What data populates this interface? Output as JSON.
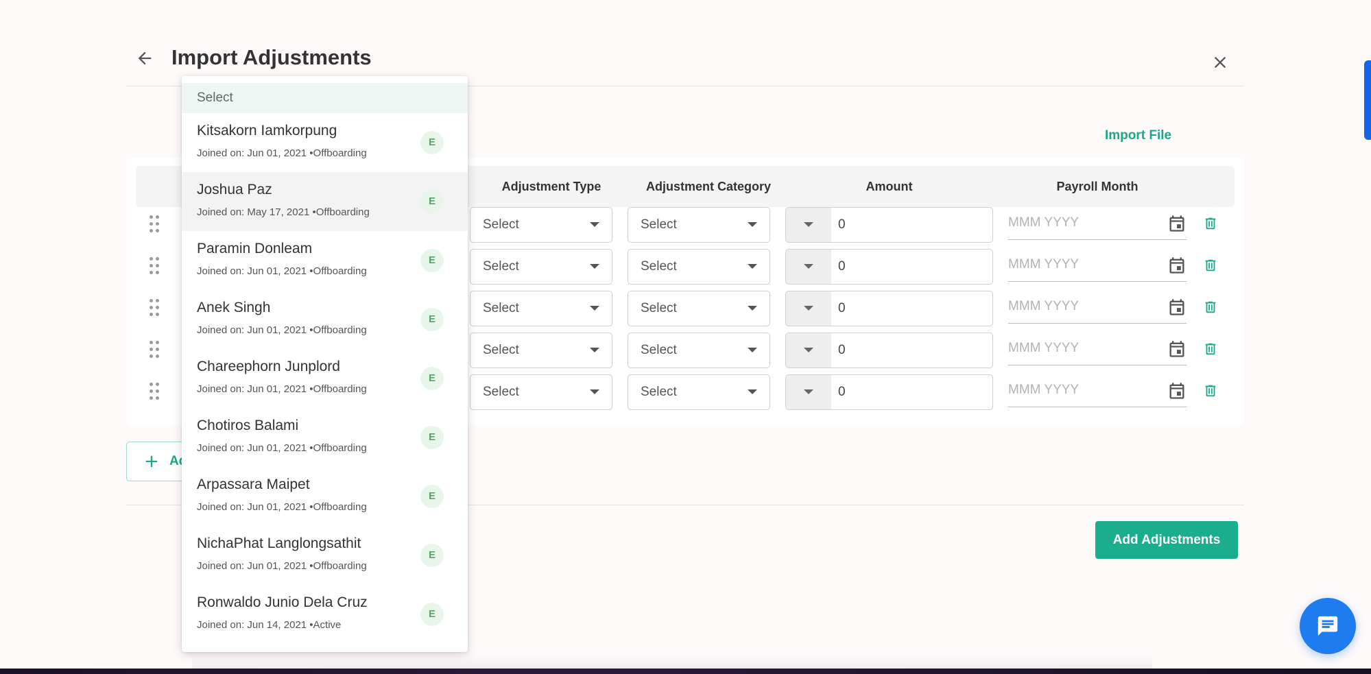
{
  "page": {
    "title": "Import Adjustments",
    "import_file_label": "Import File",
    "add_row_label": "Ad",
    "submit_label": "Add Adjustments"
  },
  "table": {
    "columns": [
      "Adjustment Type",
      "Adjustment Category",
      "Amount",
      "Payroll Month"
    ],
    "rows": [
      {
        "adjustment_type": "Select",
        "adjustment_category": "Select",
        "amount": "0",
        "payroll_month_placeholder": "MMM YYYY"
      },
      {
        "adjustment_type": "Select",
        "adjustment_category": "Select",
        "amount": "0",
        "payroll_month_placeholder": "MMM YYYY"
      },
      {
        "adjustment_type": "Select",
        "adjustment_category": "Select",
        "amount": "0",
        "payroll_month_placeholder": "MMM YYYY"
      },
      {
        "adjustment_type": "Select",
        "adjustment_category": "Select",
        "amount": "0",
        "payroll_month_placeholder": "MMM YYYY"
      },
      {
        "adjustment_type": "Select",
        "adjustment_category": "Select",
        "amount": "0",
        "payroll_month_placeholder": "MMM YYYY"
      }
    ]
  },
  "employee_dropdown": {
    "placeholder": "Select",
    "options": [
      {
        "name": "Kitsakorn Iamkorpung",
        "meta": "Joined on: Jun 01, 2021 •Offboarding",
        "badge": "E"
      },
      {
        "name": "Joshua Paz",
        "meta": "Joined on: May 17, 2021 •Offboarding",
        "badge": "E"
      },
      {
        "name": "Paramin Donleam",
        "meta": "Joined on: Jun 01, 2021 •Offboarding",
        "badge": "E"
      },
      {
        "name": "Anek Singh",
        "meta": "Joined on: Jun 01, 2021 •Offboarding",
        "badge": "E"
      },
      {
        "name": "Chareephorn Junplord",
        "meta": "Joined on: Jun 01, 2021 •Offboarding",
        "badge": "E"
      },
      {
        "name": "Chotiros Balami",
        "meta": "Joined on: Jun 01, 2021 •Offboarding",
        "badge": "E"
      },
      {
        "name": "Arpassara Maipet",
        "meta": "Joined on: Jun 01, 2021 •Offboarding",
        "badge": "E"
      },
      {
        "name": "NichaPhat Langlongsathit",
        "meta": "Joined on: Jun 01, 2021 •Offboarding",
        "badge": "E"
      },
      {
        "name": "Ronwaldo Junio Dela Cruz",
        "meta": "Joined on: Jun 14, 2021 •Active",
        "badge": "E"
      }
    ]
  },
  "icons": {
    "back": "arrow-left-icon",
    "close": "close-icon",
    "drag": "drag-handle-icon",
    "calendar": "calendar-icon",
    "delete": "trash-icon",
    "add": "plus-icon",
    "chat": "chat-icon"
  },
  "colors": {
    "accent": "#1aae8e",
    "accent_text": "#1aa88a",
    "chat": "#1e7cf0",
    "dropdown_header": "#edf6f2",
    "badge_bg": "#e8f5ea"
  }
}
